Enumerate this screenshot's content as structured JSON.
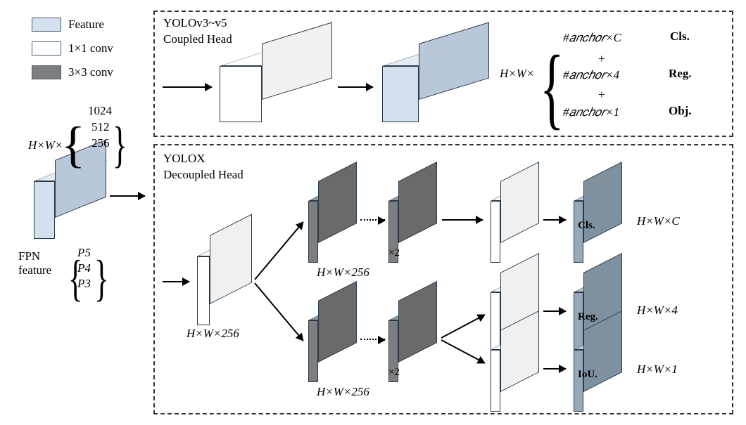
{
  "legend": {
    "feature": "Feature",
    "conv1": "1×1 conv",
    "conv3": "3×3 conv"
  },
  "fpn": {
    "dims_prefix": "H×W×",
    "channel_opts": [
      "1024",
      "512",
      "256"
    ],
    "label": "FPN feature",
    "level_opts": [
      "P5",
      "P4",
      "P3"
    ]
  },
  "coupled": {
    "title_l1": "YOLOv3~v5",
    "title_l2": "Coupled Head",
    "out_prefix": "H×W×",
    "row1": "#𝑎𝑛𝑐ℎ𝑜𝑟×C",
    "row1_tag": "Cls.",
    "row2": "#𝑎𝑛𝑐ℎ𝑜𝑟×4",
    "row2_tag": "Reg.",
    "row3": "#𝑎𝑛𝑐ℎ𝑜𝑟×1",
    "row3_tag": "Obj.",
    "plus": "+"
  },
  "decoupled": {
    "title_l1": "YOLOX",
    "title_l2": "Decoupled Head",
    "stem": "H×W×256",
    "branch": "H×W×256",
    "x2": "×2",
    "cls_tag": "Cls.",
    "cls_dim": "H×W×C",
    "reg_tag": "Reg.",
    "reg_dim": "H×W×4",
    "iou_tag": "IoU.",
    "iou_dim": "H×W×1"
  }
}
